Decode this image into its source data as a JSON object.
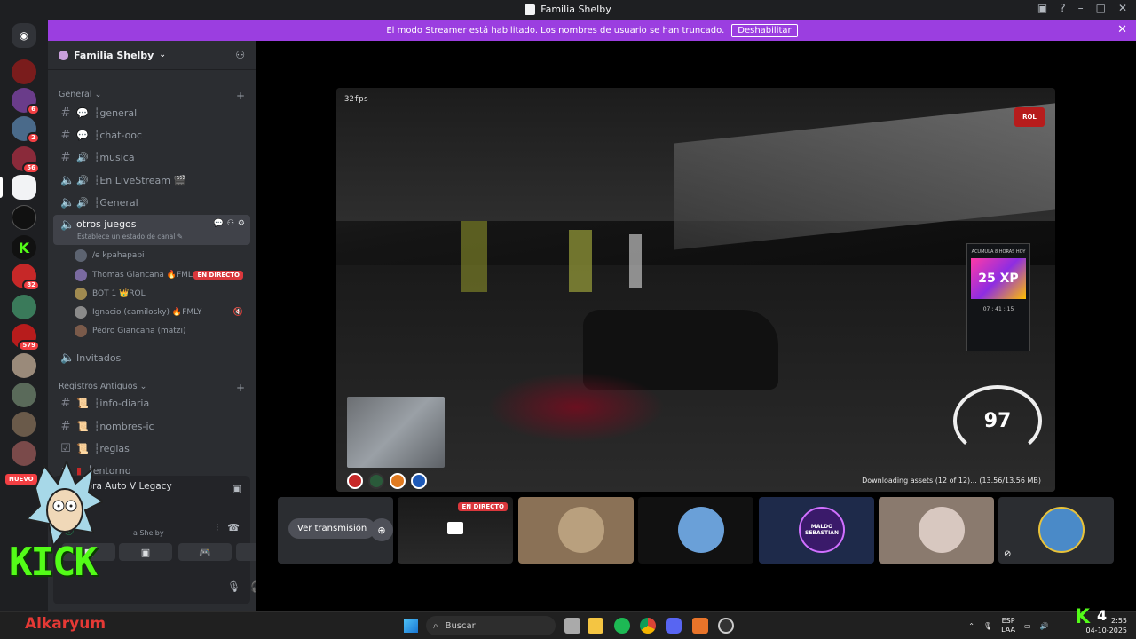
{
  "window": {
    "title": "Familia Shelby"
  },
  "banner": {
    "text": "El modo Streamer está habilitado. Los nombres de usuario se han truncado.",
    "button": "Deshabilitar",
    "close": "✕"
  },
  "guilds": {
    "badges": [
      "6",
      "2",
      "56",
      "82",
      "579"
    ],
    "new_label": "NUEVO"
  },
  "server": {
    "name": "Familia Shelby"
  },
  "categories": [
    {
      "label": "General"
    },
    {
      "label": "Registros Antiguos"
    }
  ],
  "channels": [
    {
      "icon": "💬",
      "label": "┆general"
    },
    {
      "icon": "💬",
      "label": "┆chat-ooc"
    },
    {
      "icon": "🔊",
      "label": "┆musica"
    },
    {
      "icon": "🔊",
      "label": "┆En LiveStream 🎬"
    },
    {
      "icon": "🔊",
      "label": "┆General"
    }
  ],
  "active_channel": {
    "label": "otros juegos",
    "status": "Establece un estado de canal ✎"
  },
  "voice_users": [
    {
      "name": "/e kpahapapi",
      "live": ""
    },
    {
      "name": "Thomas Giancana 🔥FML",
      "live": "EN DIRECTO"
    },
    {
      "name": "BOT 1 👑ROL",
      "live": ""
    },
    {
      "name": "Ignacio (camilosky) 🔥FMLY",
      "live": ""
    },
    {
      "name": "Pédro Giancana (matzi)",
      "live": ""
    }
  ],
  "invitados": "Invitados",
  "old_channels": [
    {
      "label": "┆info-diaria"
    },
    {
      "label": "┆nombres-ic"
    },
    {
      "label": "┆reglas"
    },
    {
      "label": "┆entorno"
    }
  ],
  "voice_panel": {
    "title": "Gra          Auto V Legacy",
    "sub": "a Shelby"
  },
  "stream": {
    "fps": "32fps",
    "speed": "97",
    "downloading": "Downloading assets (12 of 12)... (13.56/13.56 MB)",
    "xp_title": "ACUMULA 8 HORAS HOY",
    "xp_value": "25 XP",
    "xp_timer": "07 : 41 : 15"
  },
  "tiles": {
    "watch_button": "Ver transmisión",
    "live_label": "EN DIRECTO",
    "maldo": "MALDO SEBASTIAN"
  },
  "overlay": {
    "kick_logo": "KICK",
    "streamer_name": "Alkaryum",
    "kick_k": "K",
    "kick_count": "4"
  },
  "taskbar": {
    "search_placeholder": "Buscar",
    "lang": "ESP",
    "lang2": "LAA",
    "time": "2:55",
    "date": "04-10-2025"
  }
}
